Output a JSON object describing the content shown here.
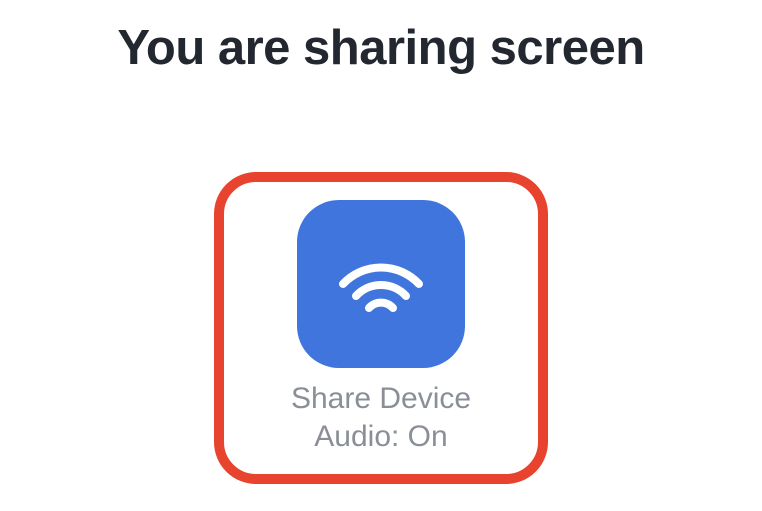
{
  "title": "You are sharing screen",
  "share_audio": {
    "icon": "wifi-arcs-icon",
    "label_line1": "Share Device",
    "label_line2": "Audio: On",
    "state": "On"
  },
  "colors": {
    "highlight": "#e8432e",
    "tile": "#4075dd",
    "title_text": "#222730",
    "label_text": "#8a8f97"
  }
}
